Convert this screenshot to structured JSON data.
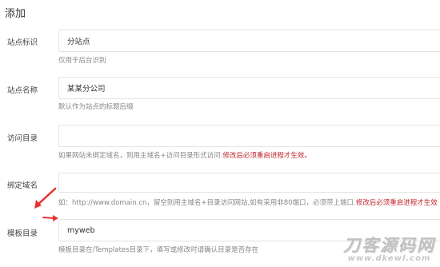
{
  "page": {
    "title": "添加"
  },
  "fields": [
    {
      "label": "站点标识",
      "value": "分站点",
      "hint": "仅用于后台识别",
      "warn": ""
    },
    {
      "label": "站点名称",
      "value": "某某分公司",
      "hint": "默认作为站点的标题后缀",
      "warn": ""
    },
    {
      "label": "访问目录",
      "value": "",
      "hint": "如果网站未绑定域名，则用主域名+访问目录形式访问.",
      "warn": "修改后必须重启进程才生效。"
    },
    {
      "label": "绑定域名",
      "value": "",
      "hint": "如：http://www.domain.cn，留空则用主域名+目录访问网站,如有采用非80端口，必须带上端口.",
      "warn": "修改后必须重启进程才生效"
    },
    {
      "label": "模板目录",
      "value": "myweb",
      "hint": "模板目录在/Templates目录下，填写或修改时请确认目录是否存在",
      "warn": ""
    }
  ],
  "annotations": {
    "arrow_color": "#e8322f"
  },
  "watermark": {
    "main": "刀客源码网",
    "sub": "www.dkewl.com"
  }
}
